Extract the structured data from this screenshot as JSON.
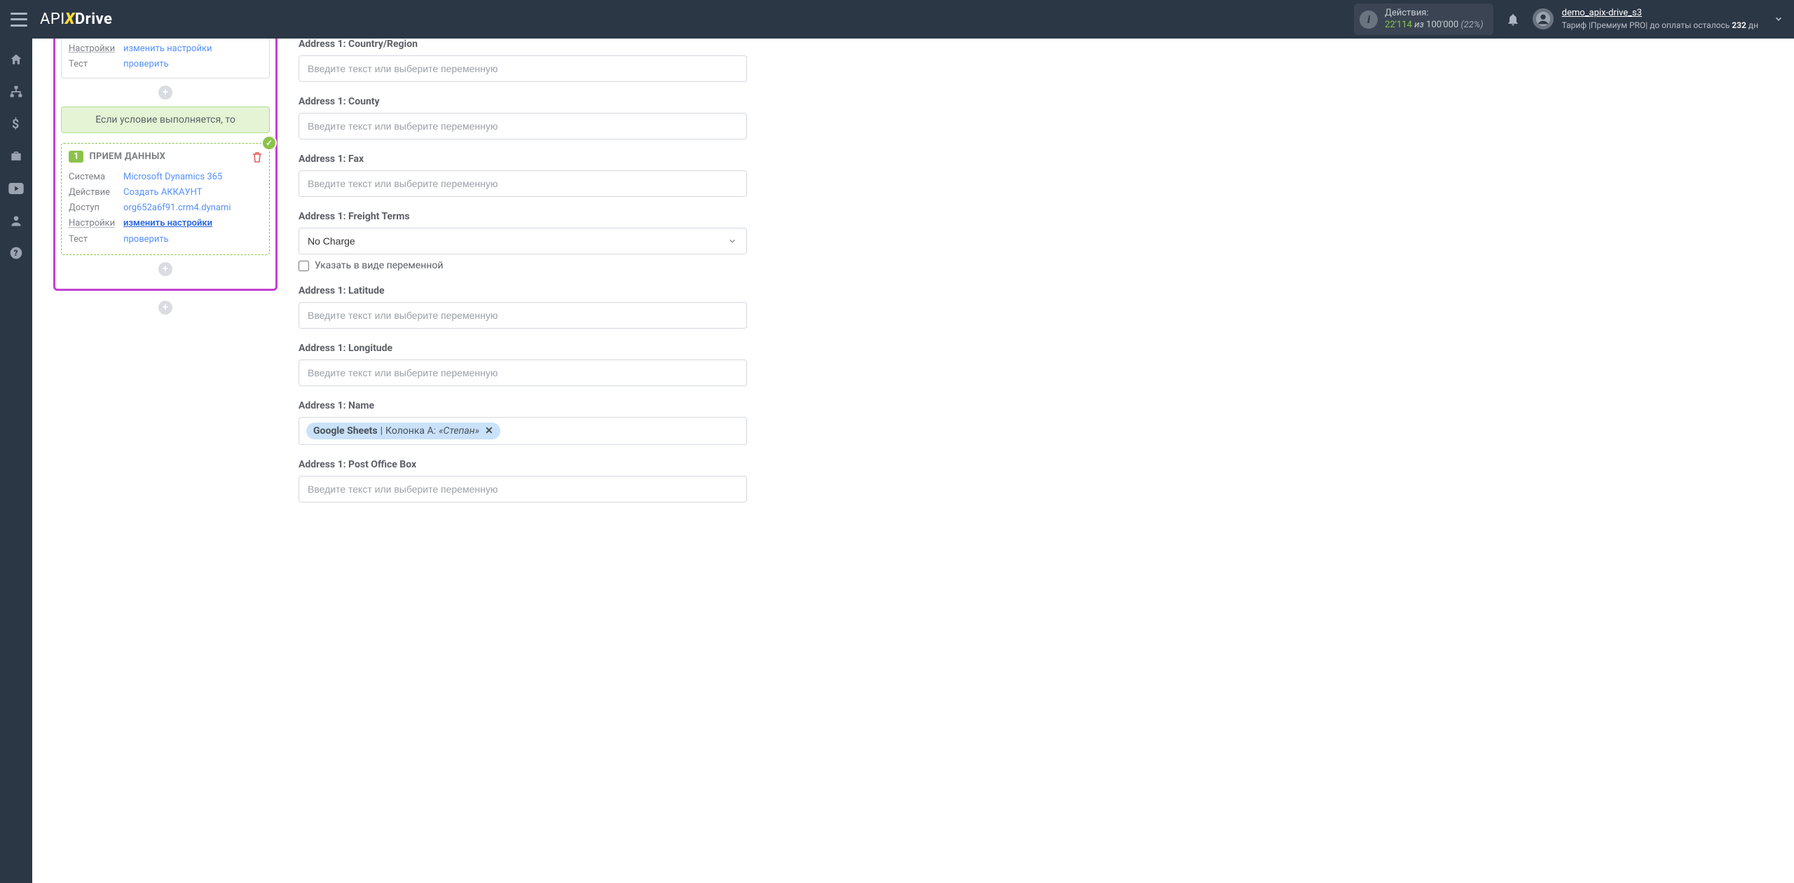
{
  "header": {
    "logo_api": "API",
    "logo_drive": "Drive",
    "actions_label": "Действия:",
    "actions_used": "22'114",
    "actions_iz": "из",
    "actions_total": "100'000",
    "actions_pct": "(22%)",
    "user_name": "demo_apix-drive_s3",
    "tariff_prefix": "Тариф |",
    "tariff_name": "Премиум PRO",
    "tariff_suffix": "| до оплаты осталось",
    "tariff_days": "232",
    "tariff_unit": "дн"
  },
  "left": {
    "top_settings_label": "Настройки",
    "top_settings_link": "изменить настройки",
    "top_test_label": "Тест",
    "top_test_link": "проверить",
    "condition_text": "Если условие выполняется, то",
    "card": {
      "num": "1",
      "title": "ПРИЕМ ДАННЫХ",
      "system_label": "Система",
      "system_value": "Microsoft Dynamics 365",
      "action_label": "Действие",
      "action_value": "Создать АККАУНТ",
      "access_label": "Доступ",
      "access_value": "org652a6f91.crm4.dynami",
      "settings_label": "Настройки",
      "settings_value": "изменить настройки",
      "test_label": "Тест",
      "test_value": "проверить"
    }
  },
  "form": {
    "placeholder": "Введите текст или выберите переменную",
    "f1_label": "Address 1: Country/Region",
    "f2_label": "Address 1: County",
    "f3_label": "Address 1: Fax",
    "f4_label": "Address 1: Freight Terms",
    "f4_value": "No Charge",
    "f4_checkbox": "Указать в виде переменной",
    "f5_label": "Address 1: Latitude",
    "f6_label": "Address 1: Longitude",
    "f7_label": "Address 1: Name",
    "f7_tag_source": "Google Sheets",
    "f7_tag_sep": " | ",
    "f7_tag_col": "Колонка A: ",
    "f7_tag_val": "«Степан»",
    "f8_label": "Address 1: Post Office Box"
  }
}
